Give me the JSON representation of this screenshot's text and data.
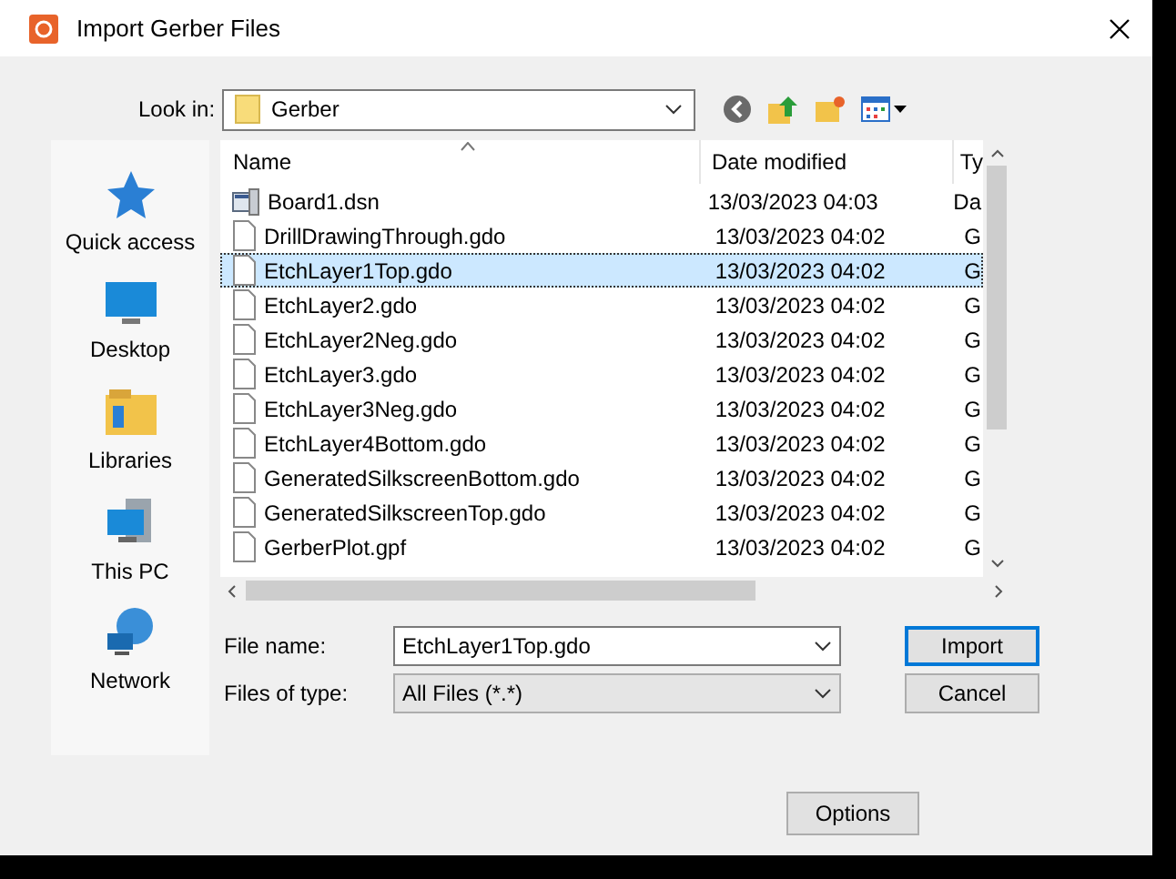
{
  "window": {
    "title": "Import Gerber Files"
  },
  "look_in": {
    "label": "Look in:",
    "value": "Gerber"
  },
  "places": [
    {
      "label": "Quick access",
      "kind": "star"
    },
    {
      "label": "Desktop",
      "kind": "desktop"
    },
    {
      "label": "Libraries",
      "kind": "libraries"
    },
    {
      "label": "This PC",
      "kind": "pc"
    },
    {
      "label": "Network",
      "kind": "network"
    }
  ],
  "columns": [
    "Name",
    "Date modified",
    "Ty"
  ],
  "files": [
    {
      "name": "Board1.dsn",
      "date": "13/03/2023 04:03",
      "type": "Da",
      "kind": "design",
      "selected": false
    },
    {
      "name": "DrillDrawingThrough.gdo",
      "date": "13/03/2023 04:02",
      "type": "G",
      "kind": "file",
      "selected": false
    },
    {
      "name": "EtchLayer1Top.gdo",
      "date": "13/03/2023 04:02",
      "type": "G",
      "kind": "file",
      "selected": true
    },
    {
      "name": "EtchLayer2.gdo",
      "date": "13/03/2023 04:02",
      "type": "G",
      "kind": "file",
      "selected": false
    },
    {
      "name": "EtchLayer2Neg.gdo",
      "date": "13/03/2023 04:02",
      "type": "G",
      "kind": "file",
      "selected": false
    },
    {
      "name": "EtchLayer3.gdo",
      "date": "13/03/2023 04:02",
      "type": "G",
      "kind": "file",
      "selected": false
    },
    {
      "name": "EtchLayer3Neg.gdo",
      "date": "13/03/2023 04:02",
      "type": "G",
      "kind": "file",
      "selected": false
    },
    {
      "name": "EtchLayer4Bottom.gdo",
      "date": "13/03/2023 04:02",
      "type": "G",
      "kind": "file",
      "selected": false
    },
    {
      "name": "GeneratedSilkscreenBottom.gdo",
      "date": "13/03/2023 04:02",
      "type": "G",
      "kind": "file",
      "selected": false
    },
    {
      "name": "GeneratedSilkscreenTop.gdo",
      "date": "13/03/2023 04:02",
      "type": "G",
      "kind": "file",
      "selected": false
    },
    {
      "name": "GerberPlot.gpf",
      "date": "13/03/2023 04:02",
      "type": "G",
      "kind": "file",
      "selected": false
    }
  ],
  "file_name": {
    "label": "File name:",
    "value": "EtchLayer1Top.gdo"
  },
  "file_type": {
    "label": "Files of type:",
    "value": "All Files (*.*)"
  },
  "buttons": {
    "import": "Import",
    "cancel": "Cancel",
    "options": "Options"
  }
}
